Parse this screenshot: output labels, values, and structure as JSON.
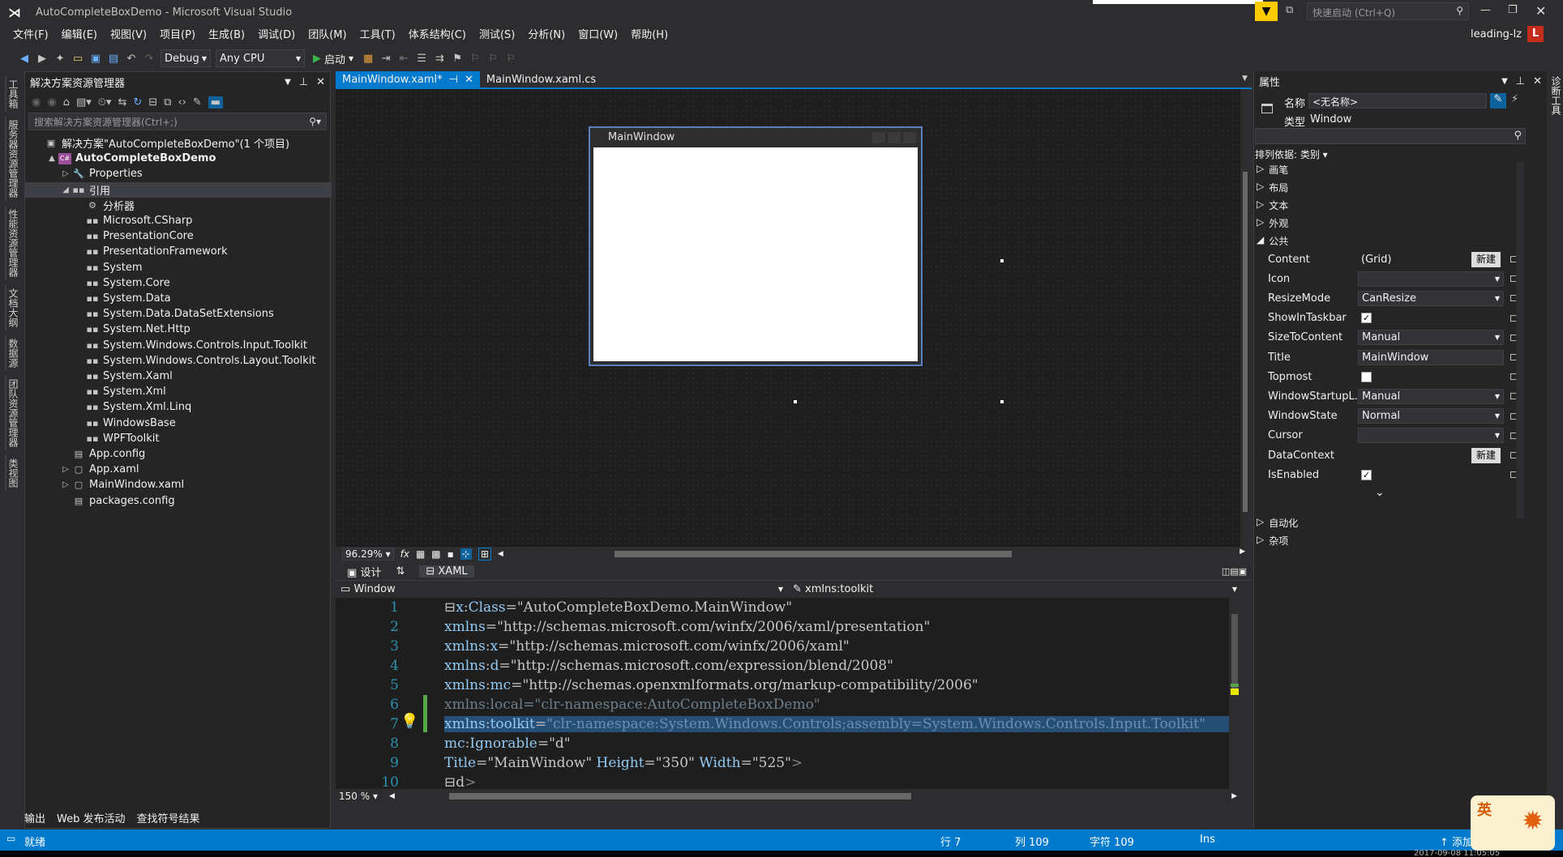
{
  "window": {
    "title": "AutoCompleteBoxDemo - Microsoft Visual Studio",
    "quick_launch": "快速启动 (Ctrl+Q)",
    "user": "leading-lz",
    "avatar": "L"
  },
  "menu": [
    "文件(F)",
    "编辑(E)",
    "视图(V)",
    "项目(P)",
    "生成(B)",
    "调试(D)",
    "团队(M)",
    "工具(T)",
    "体系结构(C)",
    "测试(S)",
    "分析(N)",
    "窗口(W)",
    "帮助(H)"
  ],
  "toolbar": {
    "config": "Debug",
    "platform": "Any CPU",
    "start": "启动"
  },
  "left_strip": [
    "工具箱",
    "服务器资源管理器",
    "性能资源管理器",
    "文档大纲",
    "数据源",
    "团队资源管理器",
    "类视图"
  ],
  "solution_explorer": {
    "title": "解决方案资源管理器",
    "search_placeholder": "搜索解决方案资源管理器(Ctrl+;)",
    "items": [
      {
        "label": "解决方案\"AutoCompleteBoxDemo\"(1 个项目)",
        "level": 0,
        "arrow": "",
        "icon": "solution-icon"
      },
      {
        "label": "AutoCompleteBoxDemo",
        "level": 1,
        "arrow": "▲",
        "icon": "csharp-project-icon",
        "bold": true
      },
      {
        "label": "Properties",
        "level": 2,
        "arrow": "▷",
        "icon": "wrench-icon"
      },
      {
        "label": "引用",
        "level": 2,
        "arrow": "◢",
        "icon": "reference-icon",
        "selected": true
      },
      {
        "label": "分析器",
        "level": 3,
        "arrow": "",
        "icon": "analyzer-icon"
      },
      {
        "label": "Microsoft.CSharp",
        "level": 3,
        "arrow": "",
        "icon": "reference-icon"
      },
      {
        "label": "PresentationCore",
        "level": 3,
        "arrow": "",
        "icon": "reference-icon"
      },
      {
        "label": "PresentationFramework",
        "level": 3,
        "arrow": "",
        "icon": "reference-icon"
      },
      {
        "label": "System",
        "level": 3,
        "arrow": "",
        "icon": "reference-icon"
      },
      {
        "label": "System.Core",
        "level": 3,
        "arrow": "",
        "icon": "reference-icon"
      },
      {
        "label": "System.Data",
        "level": 3,
        "arrow": "",
        "icon": "reference-icon"
      },
      {
        "label": "System.Data.DataSetExtensions",
        "level": 3,
        "arrow": "",
        "icon": "reference-icon"
      },
      {
        "label": "System.Net.Http",
        "level": 3,
        "arrow": "",
        "icon": "reference-icon"
      },
      {
        "label": "System.Windows.Controls.Input.Toolkit",
        "level": 3,
        "arrow": "",
        "icon": "reference-icon"
      },
      {
        "label": "System.Windows.Controls.Layout.Toolkit",
        "level": 3,
        "arrow": "",
        "icon": "reference-icon"
      },
      {
        "label": "System.Xaml",
        "level": 3,
        "arrow": "",
        "icon": "reference-icon"
      },
      {
        "label": "System.Xml",
        "level": 3,
        "arrow": "",
        "icon": "reference-icon"
      },
      {
        "label": "System.Xml.Linq",
        "level": 3,
        "arrow": "",
        "icon": "reference-icon"
      },
      {
        "label": "WindowsBase",
        "level": 3,
        "arrow": "",
        "icon": "reference-icon"
      },
      {
        "label": "WPFToolkit",
        "level": 3,
        "arrow": "",
        "icon": "reference-icon"
      },
      {
        "label": "App.config",
        "level": 2,
        "arrow": "",
        "icon": "config-file-icon"
      },
      {
        "label": "App.xaml",
        "level": 2,
        "arrow": "▷",
        "icon": "xaml-file-icon"
      },
      {
        "label": "MainWindow.xaml",
        "level": 2,
        "arrow": "▷",
        "icon": "xaml-file-icon"
      },
      {
        "label": "packages.config",
        "level": 2,
        "arrow": "",
        "icon": "config-file-icon"
      }
    ]
  },
  "tabs": [
    {
      "label": "MainWindow.xaml*",
      "active": true
    },
    {
      "label": "MainWindow.xaml.cs",
      "active": false
    }
  ],
  "designer": {
    "window_title": "MainWindow",
    "zoom": "96.29%",
    "fx": "fx"
  },
  "split": {
    "design": "设计",
    "swap": "⇅",
    "xaml": "XAML"
  },
  "nav": {
    "left": "Window",
    "right": "xmlns:toolkit"
  },
  "code_lines": [
    {
      "n": "1",
      "parts": [
        [
          "⊟",
          "#bbb"
        ],
        [
          "x",
          "#92caf4"
        ],
        [
          ":",
          "#bbb"
        ],
        [
          "Class",
          "#92caf4"
        ],
        [
          "=",
          "#bbb"
        ],
        [
          "\"AutoCompleteBoxDemo.MainWindow\"",
          "#c8c8c8"
        ]
      ]
    },
    {
      "n": "2",
      "parts": [
        [
          "xmlns",
          "#92caf4"
        ],
        [
          "=",
          "#bbb"
        ],
        [
          "\"http://schemas.microsoft.com/winfx/2006/xaml/presentation\"",
          "#c8c8c8"
        ]
      ]
    },
    {
      "n": "3",
      "parts": [
        [
          "xmlns",
          "#92caf4"
        ],
        [
          ":",
          "#bbb"
        ],
        [
          "x",
          "#92caf4"
        ],
        [
          "=",
          "#bbb"
        ],
        [
          "\"http://schemas.microsoft.com/winfx/2006/xaml\"",
          "#c8c8c8"
        ]
      ]
    },
    {
      "n": "4",
      "parts": [
        [
          "xmlns",
          "#92caf4"
        ],
        [
          ":",
          "#bbb"
        ],
        [
          "d",
          "#92caf4"
        ],
        [
          "=",
          "#bbb"
        ],
        [
          "\"http://schemas.microsoft.com/expression/blend/2008\"",
          "#c8c8c8"
        ]
      ]
    },
    {
      "n": "5",
      "parts": [
        [
          "xmlns",
          "#92caf4"
        ],
        [
          ":",
          "#bbb"
        ],
        [
          "mc",
          "#92caf4"
        ],
        [
          "=",
          "#bbb"
        ],
        [
          "\"http://schemas.openxmlformats.org/markup-compatibility/2006\"",
          "#c8c8c8"
        ]
      ]
    },
    {
      "n": "6",
      "parts": [
        [
          "xmlns:local=\"clr-namespace:AutoCompleteBoxDemo\"",
          "#6d7f8c"
        ]
      ]
    },
    {
      "n": "7",
      "parts": [
        [
          "xmlns",
          "#92caf4"
        ],
        [
          ":",
          "#bbb"
        ],
        [
          "toolkit",
          "#92caf4"
        ],
        [
          "=",
          "#bbb"
        ],
        [
          "\"clr-namespace:System.Windows.Controls;assembly=System.Windows.Controls.Input.Toolkit\"",
          "#6d8fb0"
        ]
      ],
      "highlight": true
    },
    {
      "n": "8",
      "parts": [
        [
          "mc",
          "#92caf4"
        ],
        [
          ":",
          "#bbb"
        ],
        [
          "Ignorable",
          "#92caf4"
        ],
        [
          "=",
          "#bbb"
        ],
        [
          "\"d\"",
          "#c8c8c8"
        ]
      ]
    },
    {
      "n": "9",
      "parts": [
        [
          "Title",
          "#92caf4"
        ],
        [
          "=",
          "#bbb"
        ],
        [
          "\"MainWindow\"",
          "#c8c8c8"
        ],
        [
          " Height",
          "#92caf4"
        ],
        [
          "=",
          "#bbb"
        ],
        [
          "\"350\"",
          "#c8c8c8"
        ],
        [
          " Width",
          "#92caf4"
        ],
        [
          "=",
          "#bbb"
        ],
        [
          "\"525\"",
          "#c8c8c8"
        ],
        [
          ">",
          "#808080"
        ]
      ]
    },
    {
      "n": "10",
      "parts": [
        [
          "⊟",
          "#bbb"
        ],
        [
          "d",
          "#c8c8c8"
        ],
        [
          ">",
          "#808080"
        ]
      ]
    }
  ],
  "code_zoom": "150 %",
  "properties": {
    "title": "属性",
    "name_label": "名称",
    "name_value": "<无名称>",
    "type_label": "类型",
    "type_value": "Window",
    "sort": "排列依据: 类别 ▾",
    "categories_top": [
      "画笔",
      "布局",
      "文本",
      "外观"
    ],
    "common": "公共",
    "rows": [
      {
        "name": "Content",
        "value": "(Grid)",
        "kind": "text",
        "btn": "新建"
      },
      {
        "name": "Icon",
        "value": "",
        "kind": "combo"
      },
      {
        "name": "ResizeMode",
        "value": "CanResize",
        "kind": "combo"
      },
      {
        "name": "ShowInTaskbar",
        "value": "✓",
        "kind": "check"
      },
      {
        "name": "SizeToContent",
        "value": "Manual",
        "kind": "combo"
      },
      {
        "name": "Title",
        "value": "MainWindow",
        "kind": "box"
      },
      {
        "name": "Topmost",
        "value": "",
        "kind": "check"
      },
      {
        "name": "WindowStartupL...",
        "value": "Manual",
        "kind": "combo"
      },
      {
        "name": "WindowState",
        "value": "Normal",
        "kind": "combo"
      },
      {
        "name": "Cursor",
        "value": "",
        "kind": "combo"
      },
      {
        "name": "DataContext",
        "value": "",
        "kind": "text",
        "btn": "新建"
      },
      {
        "name": "IsEnabled",
        "value": "✓",
        "kind": "check"
      }
    ],
    "categories_bottom": [
      "自动化",
      "杂项"
    ]
  },
  "right_strip": "诊断工具",
  "bottom_tabs": [
    "输出",
    "Web 发布活动",
    "查找符号结果"
  ],
  "status": {
    "ready": "就绪",
    "line": "行 7",
    "col": "列 109",
    "char": "字符 109",
    "mode": "Ins",
    "add": "↑ 添加",
    "clock": "2017-09-08 11:05:05"
  },
  "ime": "英"
}
